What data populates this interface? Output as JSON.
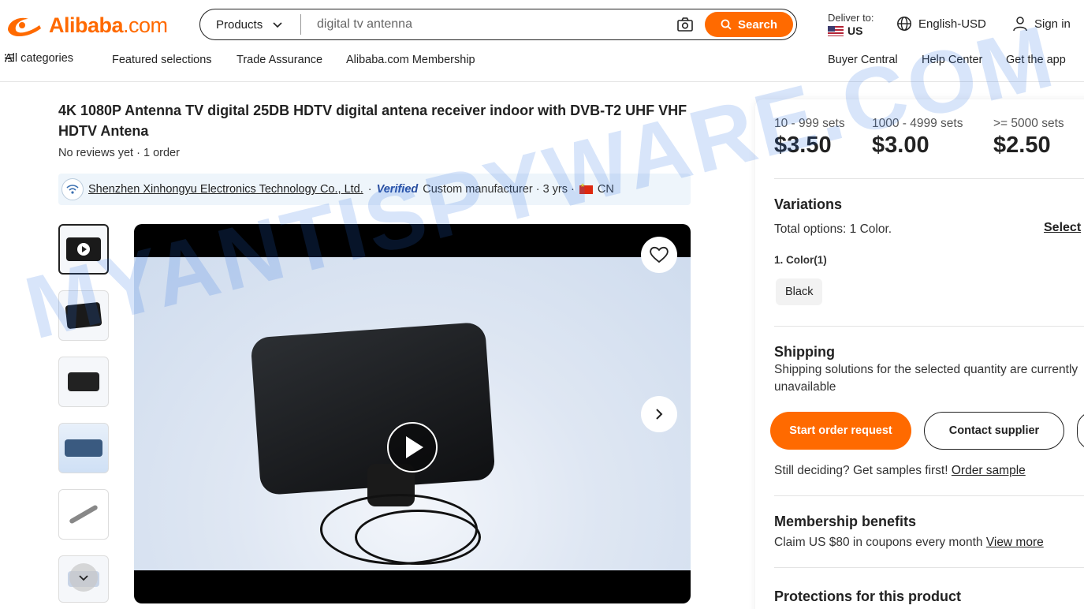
{
  "header": {
    "logo_text": "Alibaba",
    "logo_suffix": ".com",
    "search": {
      "category": "Products",
      "placeholder": "digital tv antenna",
      "button_label": "Search"
    },
    "deliver_label": "Deliver to:",
    "deliver_country": "US",
    "language": "English-USD",
    "signin": "Sign in"
  },
  "subnav": {
    "all_categories": "All categories",
    "featured": "Featured selections",
    "trade_assurance": "Trade Assurance",
    "membership": "Alibaba.com Membership",
    "buyer_central": "Buyer Central",
    "help_center": "Help Center",
    "get_app": "Get the app"
  },
  "product": {
    "title": "4K 1080P Antenna TV digital 25DB HDTV digital antena receiver indoor with DVB-T2 UHF VHF HDTV Antena",
    "reviews": "No reviews yet · 1 order",
    "supplier": {
      "name": "Shenzhen Xinhongyu Electronics Technology Co., Ltd.",
      "sep1": "·",
      "verified": "Verified",
      "type": "Custom manufacturer · 3 yrs ·",
      "country": "CN"
    }
  },
  "pricing": {
    "tiers": [
      {
        "qty": "10 - 999 sets",
        "price": "$3.50"
      },
      {
        "qty": "1000 - 4999 sets",
        "price": "$3.00"
      },
      {
        "qty": ">= 5000 sets",
        "price": "$2.50"
      }
    ]
  },
  "variations": {
    "title": "Variations",
    "total_prefix": "Total options: ",
    "total_value": "1 Color.",
    "select_label": "Select",
    "color_label": "1. Color(1)",
    "color_option": "Black"
  },
  "shipping": {
    "title": "Shipping",
    "text": "Shipping solutions for the selected quantity are currently unavailable"
  },
  "actions": {
    "start_order": "Start order request",
    "contact": "Contact supplier"
  },
  "samples": {
    "text": "Still deciding? Get samples first!",
    "link": "Order sample"
  },
  "membership": {
    "title": "Membership benefits",
    "text": "Claim US $80 in coupons every month",
    "link": "View more"
  },
  "protections": {
    "title": "Protections for this product"
  },
  "watermark": "MYANTISPYWARE.COM",
  "colors": {
    "brand_orange": "#ff6a00",
    "text_dark": "#222222",
    "supplier_bg": "#eef5fb"
  }
}
